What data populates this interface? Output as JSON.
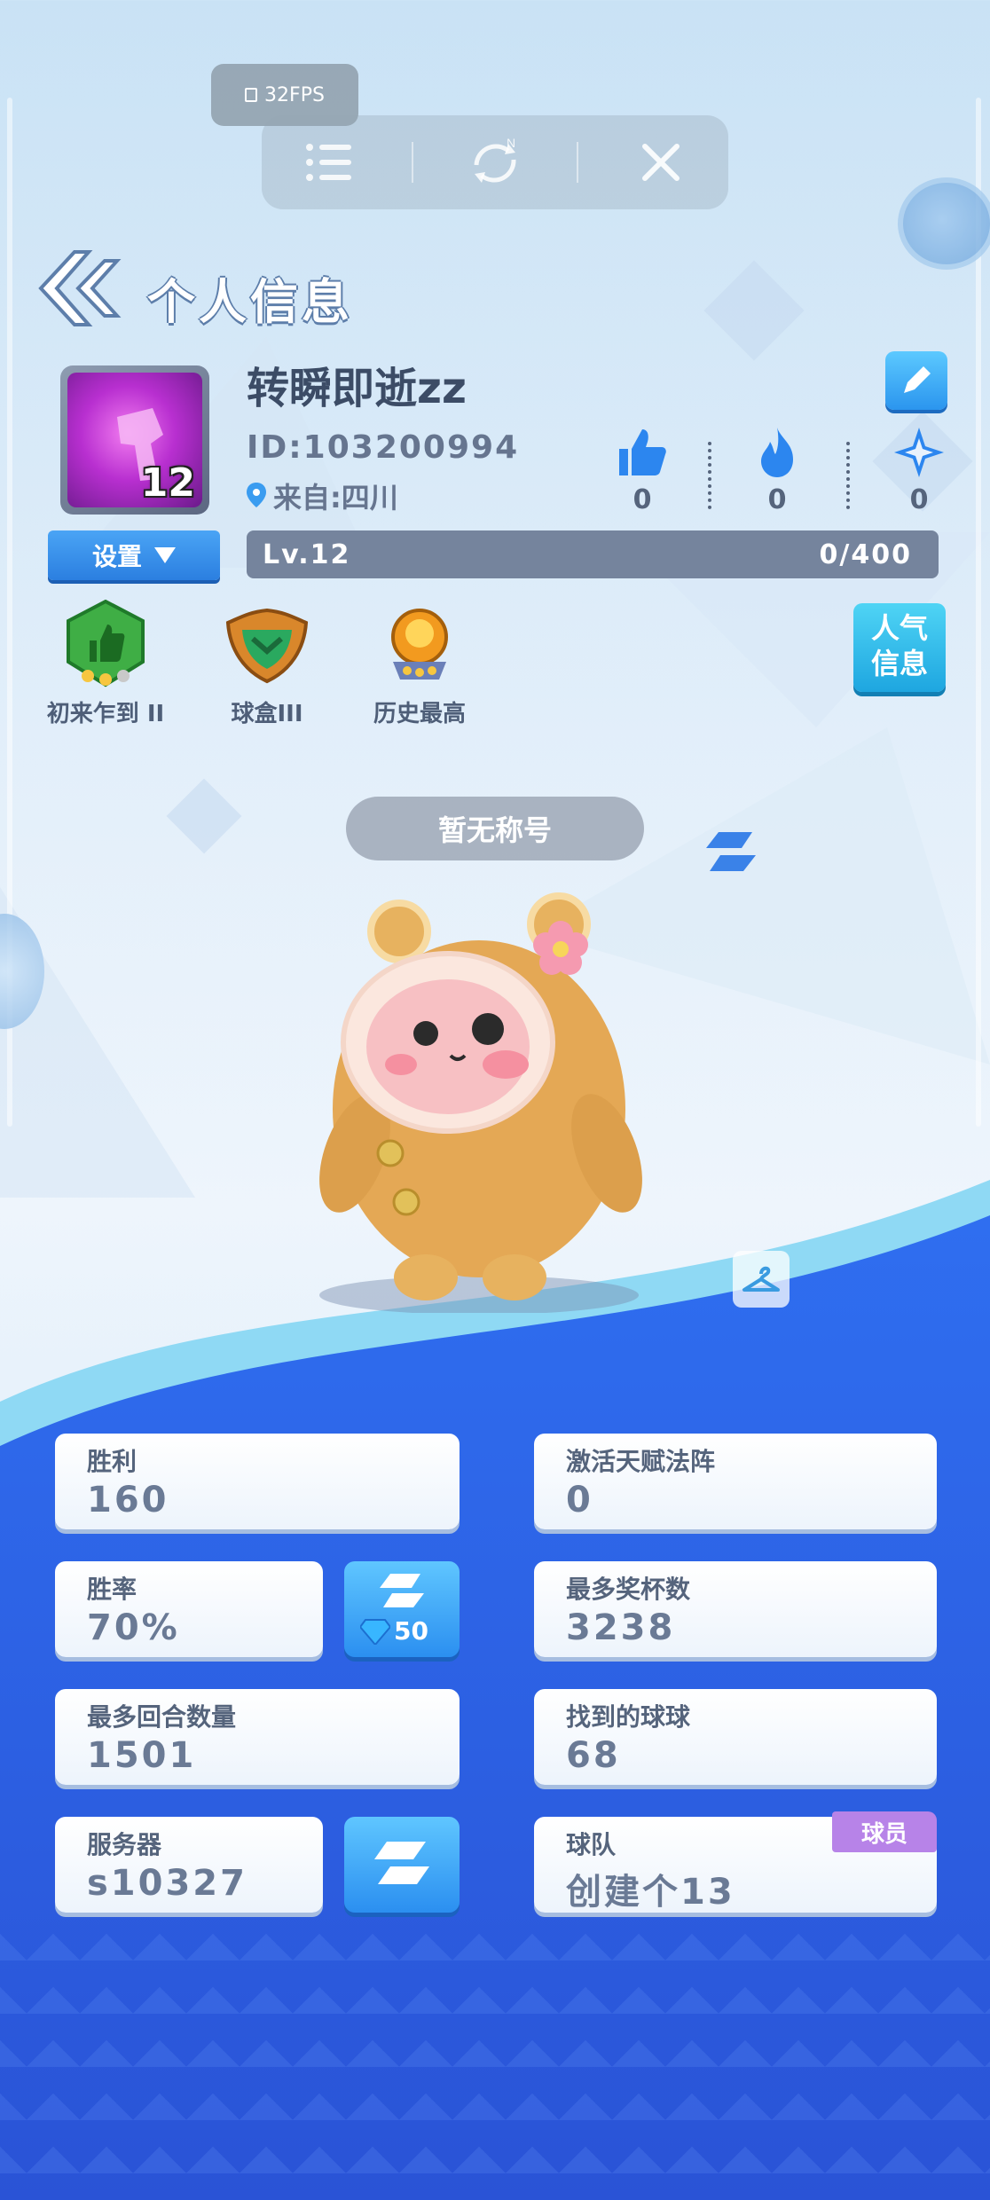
{
  "overlay": {
    "fps": "32FPS"
  },
  "header": {
    "title": "个人信息"
  },
  "profile": {
    "username": "转瞬即逝zz",
    "id": "ID:103200994",
    "from": "来自:四川",
    "avatar_level": "12",
    "likes": "0",
    "fire": "0",
    "star": "0",
    "settings_label": "设置",
    "level_label": "Lv.12",
    "exp": "0/400",
    "popularity_label_1": "人气",
    "popularity_label_2": "信息"
  },
  "badges": [
    {
      "label": "初来乍到 II",
      "icon": "thumbs-up-shield-icon"
    },
    {
      "label": "球盒III",
      "icon": "chevron-shield-icon"
    },
    {
      "label": "历史最高",
      "icon": "orb-trophy-icon"
    }
  ],
  "title_pill": "暂无称号",
  "stats": {
    "wins_label": "胜利",
    "wins": "160",
    "talent_label": "激活天赋法阵",
    "talent": "0",
    "winrate_label": "胜率",
    "winrate": "70%",
    "swap_cost": "50",
    "trophies_label": "最多奖杯数",
    "trophies": "3238",
    "rounds_label": "最多回合数量",
    "rounds": "1501",
    "balls_label": "找到的球球",
    "balls": "68",
    "server_label": "服务器",
    "server": "s10327",
    "team_label": "球队",
    "team": "创建个13",
    "team_role": "球员"
  },
  "colors": {
    "accent_blue": "#2b7fe0",
    "lower_bg": "#2f63e6",
    "card_text": "#55647c",
    "role_tag": "#b783e8"
  }
}
